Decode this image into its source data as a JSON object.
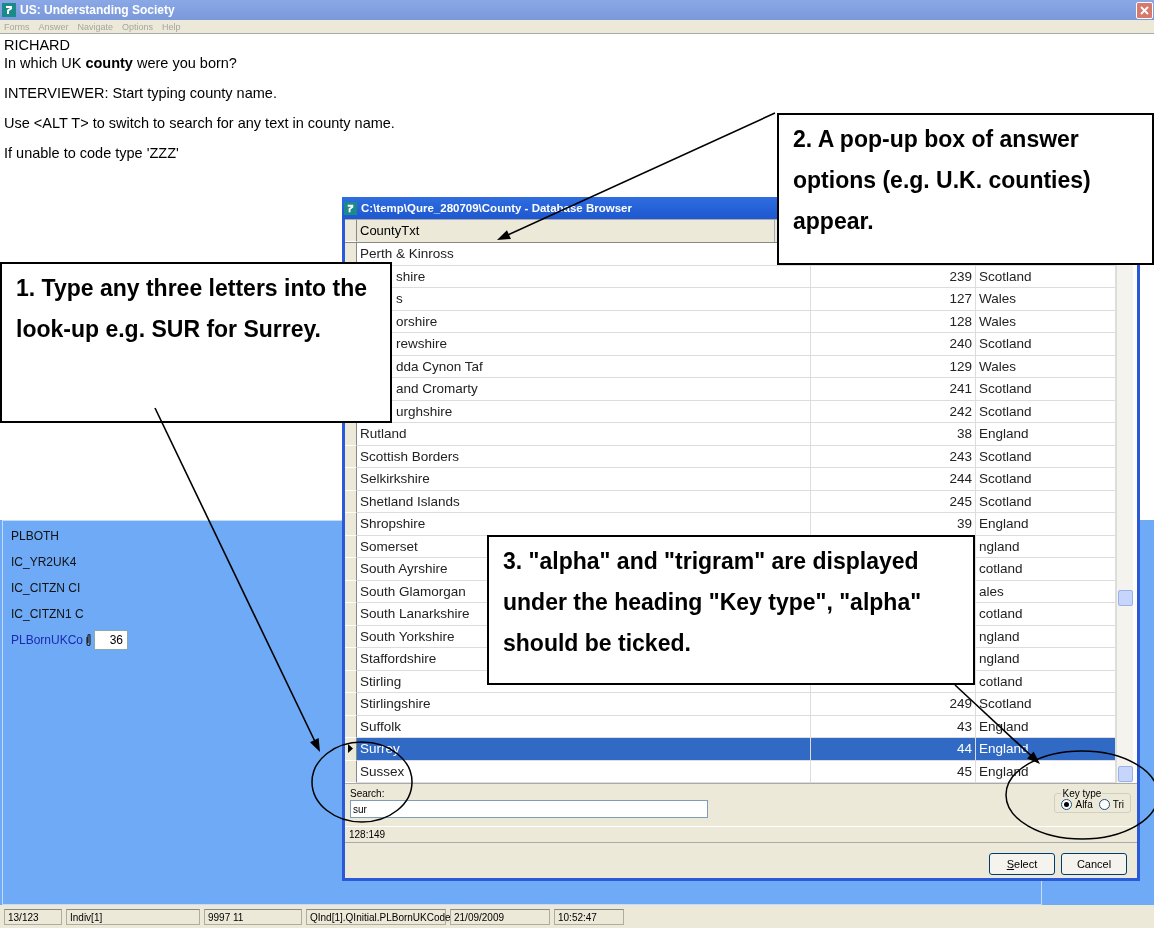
{
  "window": {
    "title": "US: Understanding Society"
  },
  "menu": [
    {
      "label": "Forms",
      "disabled": true
    },
    {
      "label": "Answer",
      "disabled": true
    },
    {
      "label": "Navigate",
      "disabled": true
    },
    {
      "label": "Options",
      "disabled": true
    },
    {
      "label": "Help",
      "disabled": true
    }
  ],
  "question": {
    "respondent": "RICHARD",
    "text": "In which UK **county** were you born?",
    "instructions": [
      "INTERVIEWER: Start typing county name.",
      "Use <ALT T> to switch to search for any text in county name.",
      "If unable to code type 'ZZZ'"
    ]
  },
  "fields": [
    {
      "name": "PLBOTH",
      "current": false
    },
    {
      "name": "IC_YR2UK4",
      "current": false
    },
    {
      "name": "IC_CITZN CI",
      "current": false
    },
    {
      "name": "IC_CITZN1 C",
      "current": false
    },
    {
      "name": "PLBornUKCo",
      "current": true,
      "value": "36"
    }
  ],
  "dialog": {
    "title": "C:\\temp\\Qure_280709\\County - Database Browser",
    "columns": [
      "CountyTxt"
    ],
    "rows": [
      {
        "county": "Perth & Kinross",
        "selected": false,
        "clipped": false
      },
      {
        "county": "shire",
        "code": "239",
        "country": "Scotland",
        "selected": false,
        "clipped": true
      },
      {
        "county": "s",
        "code": "127",
        "country": "Wales",
        "selected": false,
        "clipped": true
      },
      {
        "county": "orshire",
        "code": "128",
        "country": "Wales",
        "selected": false,
        "clipped": true
      },
      {
        "county": "rewshire",
        "code": "240",
        "country": "Scotland",
        "selected": false,
        "clipped": true
      },
      {
        "county": "dda Cynon Taf",
        "code": "129",
        "country": "Wales",
        "selected": false,
        "clipped": true
      },
      {
        "county": "and Cromarty",
        "code": "241",
        "country": "Scotland",
        "selected": false,
        "clipped": true
      },
      {
        "county": "urghshire",
        "code": "242",
        "country": "Scotland",
        "selected": false,
        "clipped": true
      },
      {
        "county": "Rutland",
        "code": "38",
        "country": "England",
        "selected": false,
        "clipped": false
      },
      {
        "county": "Scottish Borders",
        "code": "243",
        "country": "Scotland",
        "selected": false,
        "clipped": false
      },
      {
        "county": "Selkirkshire",
        "code": "244",
        "country": "Scotland",
        "selected": false,
        "clipped": false
      },
      {
        "county": "Shetland Islands",
        "code": "245",
        "country": "Scotland",
        "selected": false,
        "clipped": false
      },
      {
        "county": "Shropshire",
        "code": "39",
        "country": "England",
        "selected": false,
        "clipped": false
      },
      {
        "county": "Somerset",
        "country": "ngland",
        "selected": false,
        "clipped": false
      },
      {
        "county": "South Ayrshire",
        "country": "cotland",
        "selected": false,
        "clipped": false
      },
      {
        "county": "South Glamorgan",
        "country": "ales",
        "selected": false,
        "clipped": false
      },
      {
        "county": "South Lanarkshire",
        "country": "cotland",
        "selected": false,
        "clipped": false
      },
      {
        "county": "South Yorkshire",
        "country": "ngland",
        "selected": false,
        "clipped": false
      },
      {
        "county": "Staffordshire",
        "country": "ngland",
        "selected": false,
        "clipped": false
      },
      {
        "county": "Stirling",
        "country": "cotland",
        "selected": false,
        "clipped": false
      },
      {
        "county": "Stirlingshire",
        "code": "249",
        "country": "Scotland",
        "selected": false,
        "clipped": false
      },
      {
        "county": "Suffolk",
        "code": "43",
        "country": "England",
        "selected": false,
        "clipped": false
      },
      {
        "county": "Surrey",
        "code": "44",
        "country": "England",
        "selected": true,
        "clipped": false
      },
      {
        "county": "Sussex",
        "code": "45",
        "country": "England",
        "selected": false,
        "clipped": false
      }
    ],
    "search": {
      "label": "Search:",
      "value": "sur"
    },
    "key_type": {
      "label": "Key type",
      "options": [
        {
          "label": "Alfa",
          "selected": true
        },
        {
          "label": "Tri",
          "selected": false
        }
      ]
    },
    "record": "128:149",
    "buttons": [
      "Select",
      "Cancel"
    ]
  },
  "status_bar": [
    "13/123",
    "Indiv[1]",
    "9997 11",
    "QInd[1].QInitial.PLBornUKCode",
    "21/09/2009",
    "10:52:47"
  ],
  "callouts": [
    "1. Type any three letters into the look-up e.g. SUR for Surrey.",
    "2. A pop-up box of answer options (e.g. U.K. counties) appear.",
    "3. \"alpha\" and \"trigram\" are displayed under the heading \"Key type\", \"alpha\" should be ticked."
  ]
}
